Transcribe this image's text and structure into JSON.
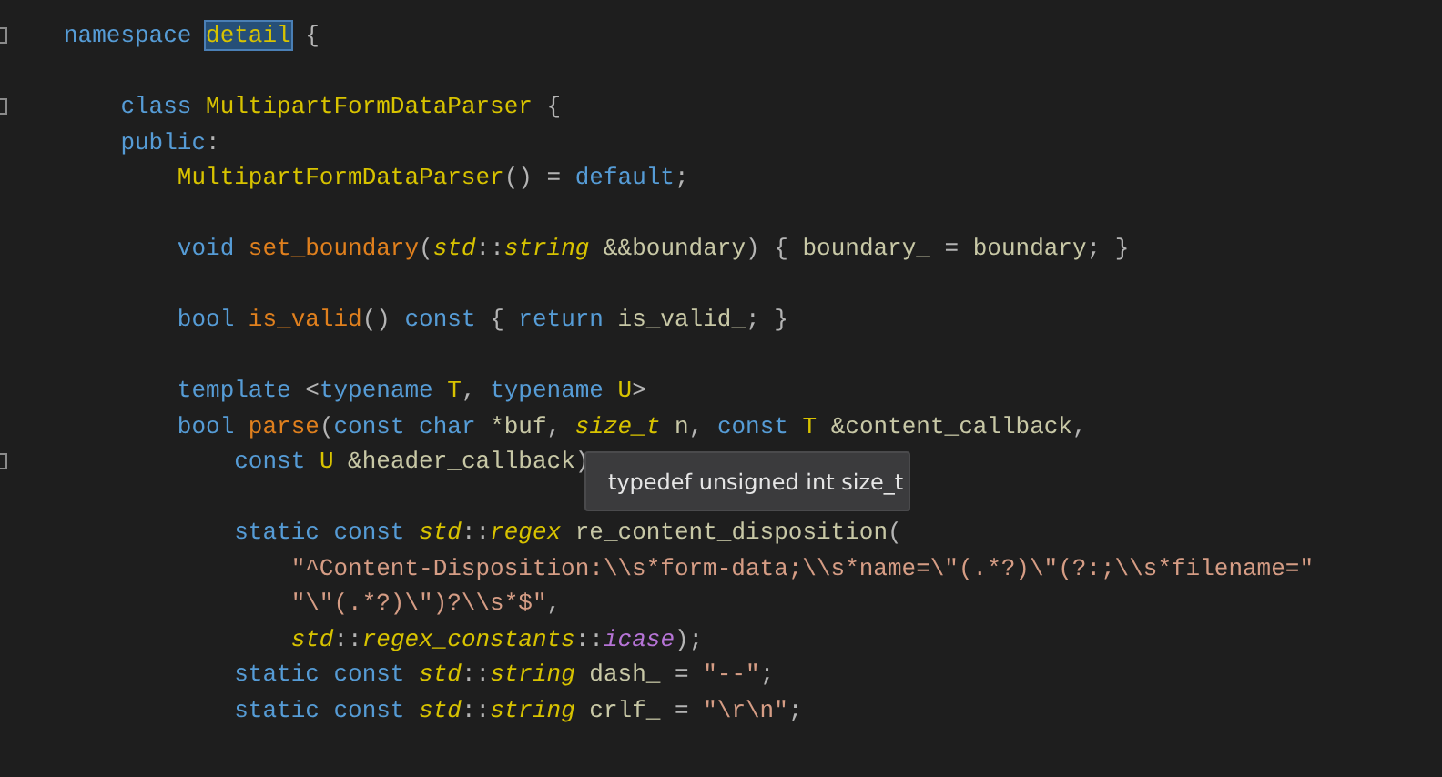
{
  "editor": {
    "lines": [
      {
        "kind": "code",
        "fold": true,
        "tokens": [
          {
            "kind": "keyword",
            "text": "namespace "
          },
          {
            "kind": "selected",
            "text": "detail"
          },
          {
            "kind": "punct",
            "text": " {"
          }
        ]
      },
      {
        "kind": "blank",
        "fold": false
      },
      {
        "kind": "code",
        "fold": true,
        "tokens": [
          {
            "kind": "keyword",
            "text": "    class "
          },
          {
            "kind": "type",
            "text": "MultipartFormDataParser"
          },
          {
            "kind": "punct",
            "text": " {"
          }
        ]
      },
      {
        "kind": "code",
        "fold": false,
        "tokens": [
          {
            "kind": "keyword",
            "text": "    public"
          },
          {
            "kind": "punct",
            "text": ":"
          }
        ]
      },
      {
        "kind": "code",
        "fold": false,
        "tokens": [
          {
            "kind": "type",
            "text": "        MultipartFormDataParser"
          },
          {
            "kind": "punct",
            "text": "() = "
          },
          {
            "kind": "keyword",
            "text": "default"
          },
          {
            "kind": "punct",
            "text": ";"
          }
        ]
      },
      {
        "kind": "blank",
        "fold": false
      },
      {
        "kind": "code",
        "fold": false,
        "tokens": [
          {
            "kind": "keyword",
            "text": "        void "
          },
          {
            "kind": "function",
            "text": "set_boundary"
          },
          {
            "kind": "punct",
            "text": "("
          },
          {
            "kind": "italic-type",
            "text": "std"
          },
          {
            "kind": "punct",
            "text": "::"
          },
          {
            "kind": "italic-type",
            "text": "string"
          },
          {
            "kind": "plain",
            "text": " &&boundary"
          },
          {
            "kind": "punct",
            "text": ") { "
          },
          {
            "kind": "plain",
            "text": "boundary_"
          },
          {
            "kind": "punct",
            "text": " = "
          },
          {
            "kind": "plain",
            "text": "boundary"
          },
          {
            "kind": "punct",
            "text": "; }"
          }
        ]
      },
      {
        "kind": "blank",
        "fold": false
      },
      {
        "kind": "code",
        "fold": false,
        "tokens": [
          {
            "kind": "keyword",
            "text": "        bool "
          },
          {
            "kind": "function",
            "text": "is_valid"
          },
          {
            "kind": "punct",
            "text": "() "
          },
          {
            "kind": "keyword",
            "text": "const"
          },
          {
            "kind": "punct",
            "text": " { "
          },
          {
            "kind": "keyword",
            "text": "return "
          },
          {
            "kind": "plain",
            "text": "is_valid_"
          },
          {
            "kind": "punct",
            "text": "; }"
          }
        ]
      },
      {
        "kind": "blank",
        "fold": false
      },
      {
        "kind": "code",
        "fold": false,
        "tokens": [
          {
            "kind": "keyword",
            "text": "        template "
          },
          {
            "kind": "punct",
            "text": "<"
          },
          {
            "kind": "keyword",
            "text": "typename "
          },
          {
            "kind": "type",
            "text": "T"
          },
          {
            "kind": "punct",
            "text": ", "
          },
          {
            "kind": "keyword",
            "text": "typename "
          },
          {
            "kind": "type",
            "text": "U"
          },
          {
            "kind": "punct",
            "text": ">"
          }
        ]
      },
      {
        "kind": "code",
        "fold": false,
        "tokens": [
          {
            "kind": "keyword",
            "text": "        bool "
          },
          {
            "kind": "function",
            "text": "parse"
          },
          {
            "kind": "punct",
            "text": "("
          },
          {
            "kind": "keyword",
            "text": "const char "
          },
          {
            "kind": "plain",
            "text": "*buf"
          },
          {
            "kind": "punct",
            "text": ", "
          },
          {
            "kind": "italic-type",
            "text": "size_t"
          },
          {
            "kind": "plain",
            "text": " n"
          },
          {
            "kind": "punct",
            "text": ", "
          },
          {
            "kind": "keyword",
            "text": "const "
          },
          {
            "kind": "type",
            "text": "T"
          },
          {
            "kind": "plain",
            "text": " &content_callback"
          },
          {
            "kind": "punct",
            "text": ","
          }
        ]
      },
      {
        "kind": "code",
        "fold": true,
        "tokens": [
          {
            "kind": "keyword",
            "text": "            const "
          },
          {
            "kind": "type",
            "text": "U"
          },
          {
            "kind": "plain",
            "text": " &header_callback"
          },
          {
            "kind": "punct",
            "text": ")"
          }
        ]
      },
      {
        "kind": "blank",
        "fold": false
      },
      {
        "kind": "code",
        "fold": false,
        "tokens": [
          {
            "kind": "keyword",
            "text": "            static const "
          },
          {
            "kind": "italic-type",
            "text": "std"
          },
          {
            "kind": "punct",
            "text": "::"
          },
          {
            "kind": "italic-type",
            "text": "regex"
          },
          {
            "kind": "plain",
            "text": " re_content_disposition"
          },
          {
            "kind": "punct",
            "text": "("
          }
        ]
      },
      {
        "kind": "code",
        "fold": false,
        "tokens": [
          {
            "kind": "string",
            "text": "                \"^Content-Disposition:\\\\s*form-data;\\\\s*name=\\\"(.*?)\\\"(?:;\\\\s*filename=\""
          }
        ]
      },
      {
        "kind": "code",
        "fold": false,
        "tokens": [
          {
            "kind": "string",
            "text": "                \"\\\"(.*?)\\\")?\\\\s*$\""
          },
          {
            "kind": "punct",
            "text": ","
          }
        ]
      },
      {
        "kind": "code",
        "fold": false,
        "tokens": [
          {
            "kind": "italic-type",
            "text": "                std"
          },
          {
            "kind": "punct",
            "text": "::"
          },
          {
            "kind": "italic-type",
            "text": "regex_constants"
          },
          {
            "kind": "punct",
            "text": "::"
          },
          {
            "kind": "enum",
            "text": "icase"
          },
          {
            "kind": "punct",
            "text": ");"
          }
        ]
      },
      {
        "kind": "code",
        "fold": false,
        "tokens": [
          {
            "kind": "keyword",
            "text": "            static const "
          },
          {
            "kind": "italic-type",
            "text": "std"
          },
          {
            "kind": "punct",
            "text": "::"
          },
          {
            "kind": "italic-type",
            "text": "string"
          },
          {
            "kind": "plain",
            "text": " dash_"
          },
          {
            "kind": "punct",
            "text": " = "
          },
          {
            "kind": "string",
            "text": "\"--\""
          },
          {
            "kind": "punct",
            "text": ";"
          }
        ]
      },
      {
        "kind": "code",
        "fold": false,
        "tokens": [
          {
            "kind": "keyword",
            "text": "            static const "
          },
          {
            "kind": "italic-type",
            "text": "std"
          },
          {
            "kind": "punct",
            "text": "::"
          },
          {
            "kind": "italic-type",
            "text": "string"
          },
          {
            "kind": "plain",
            "text": " crlf_"
          },
          {
            "kind": "punct",
            "text": " = "
          },
          {
            "kind": "string",
            "text": "\"\\r\\n\""
          },
          {
            "kind": "punct",
            "text": ";"
          }
        ]
      }
    ]
  },
  "tooltip": {
    "text": "typedef unsigned int size_t"
  }
}
